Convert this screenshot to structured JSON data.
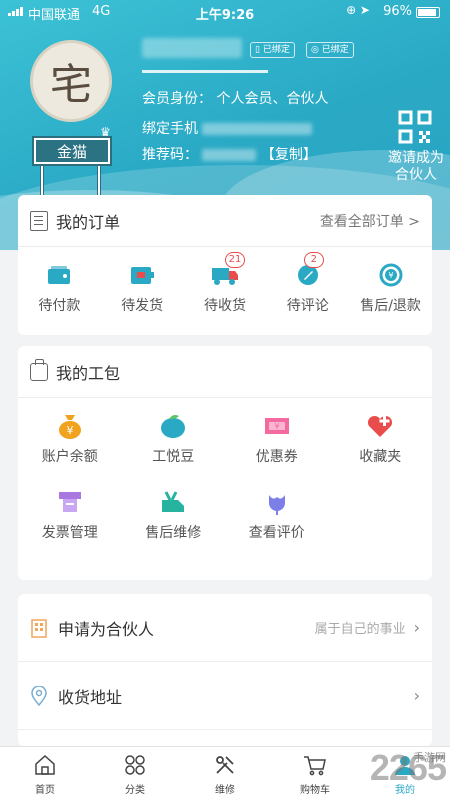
{
  "status_bar": {
    "carrier": "中国联通",
    "network": "4G",
    "time": "上午9:26",
    "battery": "96%"
  },
  "profile": {
    "avatar_char": "宅",
    "level_badge": "金猫",
    "bound_tag_1": "已绑定",
    "bound_tag_2": "已绑定",
    "member_label": "会员身份：",
    "member_value": "个人会员、合伙人",
    "phone_label": "绑定手机",
    "referral_label": "推荐码：",
    "copy_label": "【复制】",
    "invite_line1": "邀请成为",
    "invite_line2": "合伙人"
  },
  "orders": {
    "title": "我的订单",
    "view_all": "查看全部订单 >",
    "items": [
      {
        "label": "待付款",
        "icon": "wallet-icon",
        "badge": ""
      },
      {
        "label": "待发货",
        "icon": "package-icon",
        "badge": ""
      },
      {
        "label": "待收货",
        "icon": "truck-icon",
        "badge": "21"
      },
      {
        "label": "待评论",
        "icon": "pen-icon",
        "badge": "2"
      },
      {
        "label": "售后/退款",
        "icon": "refund-icon",
        "badge": ""
      }
    ]
  },
  "toolkit": {
    "title": "我的工包",
    "items": [
      {
        "label": "账户余额",
        "icon": "money-bag-icon"
      },
      {
        "label": "工悦豆",
        "icon": "bean-icon"
      },
      {
        "label": "优惠券",
        "icon": "coupon-icon"
      },
      {
        "label": "收藏夹",
        "icon": "heart-plus-icon"
      },
      {
        "label": "发票管理",
        "icon": "invoice-icon"
      },
      {
        "label": "售后维修",
        "icon": "repair-icon"
      },
      {
        "label": "查看评价",
        "icon": "flower-icon"
      }
    ]
  },
  "list": [
    {
      "label": "申请为合伙人",
      "hint": "属于自己的事业",
      "icon": "building-icon"
    },
    {
      "label": "收货地址",
      "hint": "",
      "icon": "location-pin-icon"
    }
  ],
  "tabbar": [
    {
      "label": "首页",
      "icon": "home-icon"
    },
    {
      "label": "分类",
      "icon": "category-icon"
    },
    {
      "label": "维修",
      "icon": "tools-icon"
    },
    {
      "label": "购物车",
      "icon": "cart-icon"
    },
    {
      "label": "我的",
      "icon": "profile-icon"
    }
  ],
  "watermark": {
    "text": "2265",
    "suffix": "手游网"
  },
  "colors": {
    "accent": "#2aa9c5",
    "badge_red": "#e84c4c"
  }
}
